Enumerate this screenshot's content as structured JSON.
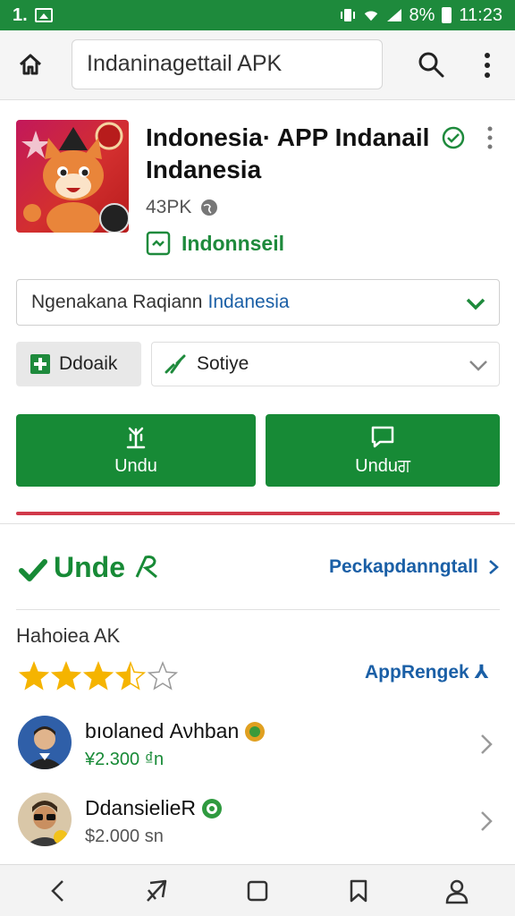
{
  "status_bar": {
    "time": "11:23",
    "left_text": "1.",
    "battery_text": "8%"
  },
  "app_bar": {
    "search_value": "Indaninagettail APK"
  },
  "app": {
    "title": "Indonesia· APP Indanail Indanesia",
    "size": "43PK",
    "developer": "Indonnseil"
  },
  "select_field": {
    "text": "Ngenakana Raqiann",
    "highlight": "Indanesia"
  },
  "filters": {
    "download_chip": "Ddoaik",
    "sort_label": "Sotiye"
  },
  "buttons": {
    "left_label": "Undu",
    "right_label": "Unduਗ"
  },
  "section": {
    "title": "Unde",
    "link": "Peckapdanngtall"
  },
  "ratings": {
    "label": "Hahoiea AK",
    "value": 3.5,
    "max": 5,
    "link": "AppRengek ⅄"
  },
  "items": [
    {
      "name": "bıolaned Ανhban",
      "price": "¥2.300 ₫n"
    },
    {
      "name": "DdansielieR",
      "price": "$2.000 sn"
    }
  ],
  "colors": {
    "green": "#178a36",
    "status_bar": "#1e8a3c",
    "link_blue": "#1a5fa6",
    "accent_red": "#d1394a",
    "star": "#f5b400"
  }
}
